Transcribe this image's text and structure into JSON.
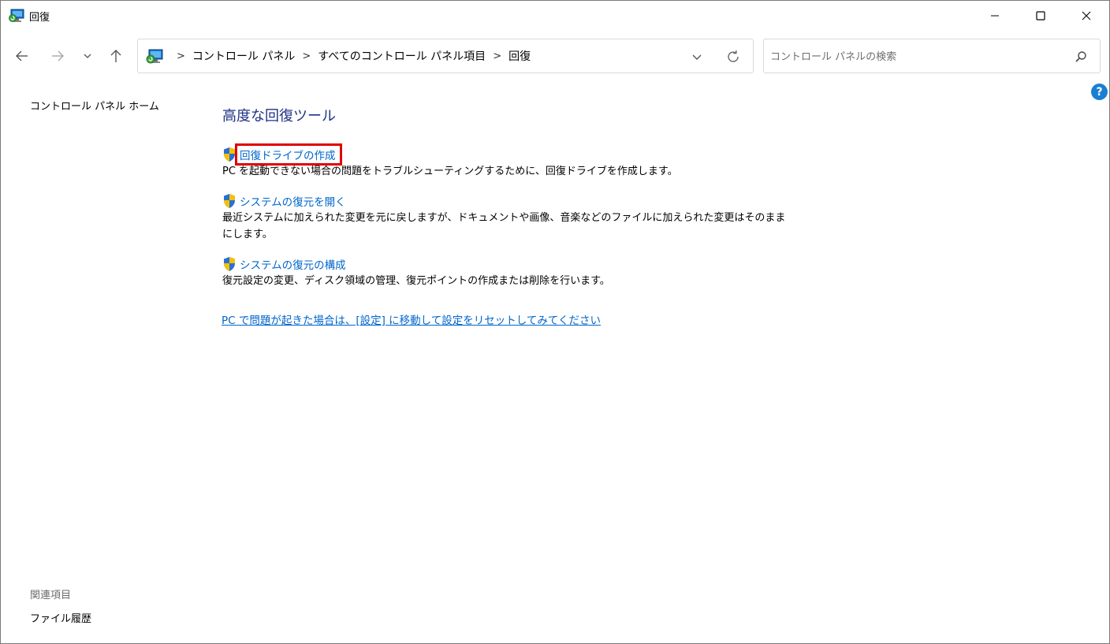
{
  "window": {
    "title": "回復",
    "minimize_label": "",
    "maximize_label": "",
    "close_label": ""
  },
  "breadcrumb": [
    "コントロール パネル",
    "すべてのコントロール パネル項目",
    "回復"
  ],
  "search": {
    "placeholder": "コントロール パネルの検索"
  },
  "sidebar": {
    "home_link": "コントロール パネル ホーム",
    "see_also_header": "関連項目",
    "see_also_items": [
      "ファイル履歴"
    ]
  },
  "main": {
    "title": "高度な回復ツール",
    "tasks": [
      {
        "link": "回復ドライブの作成",
        "description": "PC を起動できない場合の問題をトラブルシューティングするために、回復ドライブを作成します。",
        "highlighted": true
      },
      {
        "link": "システムの復元を開く",
        "description": "最近システムに加えられた変更を元に戻しますが、ドキュメントや画像、音楽などのファイルに加えられた変更はそのままにします。",
        "highlighted": false
      },
      {
        "link": "システムの復元の構成",
        "description": "復元設定の変更、ディスク領域の管理、復元ポイントの作成または削除を行います。",
        "highlighted": false
      }
    ],
    "reset_link": "PC で問題が起きた場合は、[設定] に移動して設定をリセットしてみてください"
  },
  "help": {
    "label": "?"
  },
  "colors": {
    "link": "#0066cc",
    "title": "#1e3287",
    "highlight": "#e00000",
    "help_badge": "#1a7fd4"
  },
  "icons": {
    "app": "recovery-monitor-icon",
    "shield": "uac-shield-icon",
    "back": "back-arrow-icon",
    "forward": "forward-arrow-icon",
    "recent": "chevron-down-icon",
    "up": "up-arrow-icon",
    "dropdown": "chevron-down-icon",
    "refresh": "refresh-icon",
    "search": "search-icon",
    "help": "help-icon"
  }
}
